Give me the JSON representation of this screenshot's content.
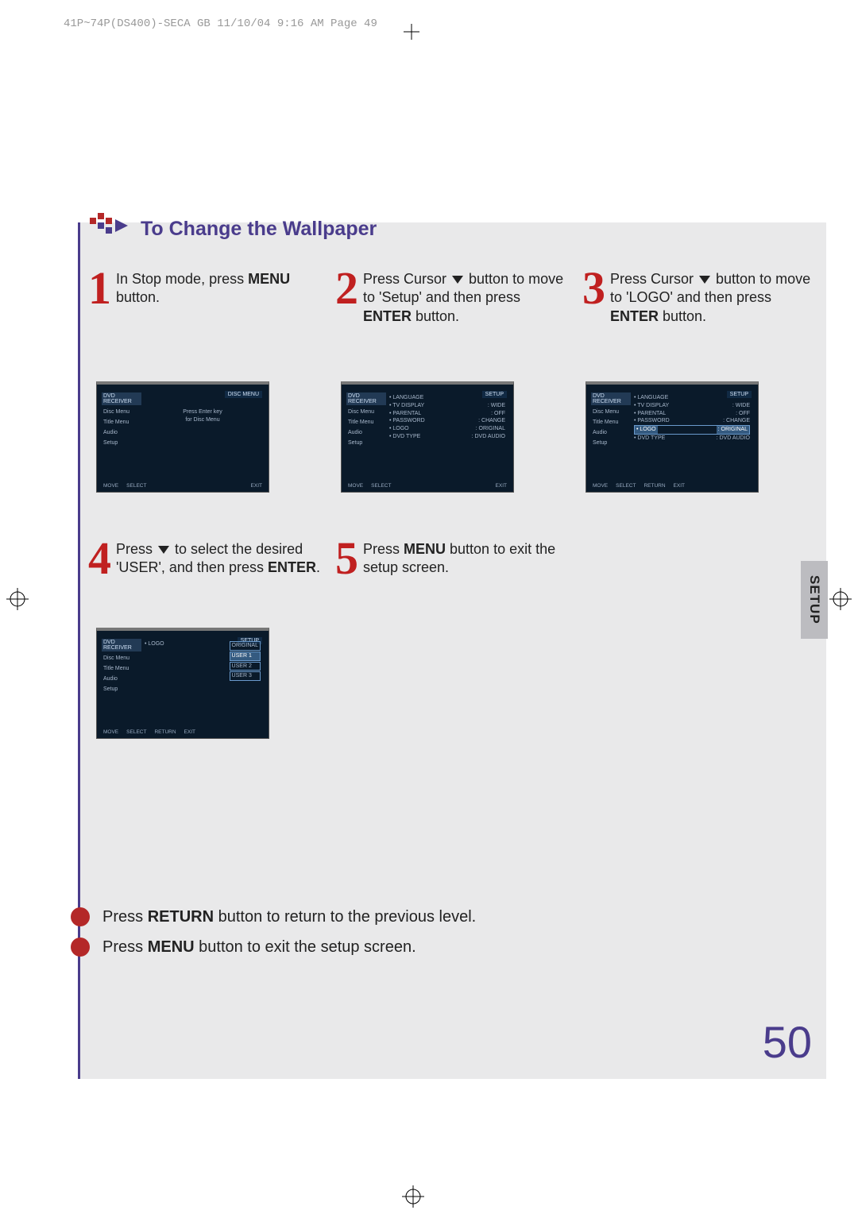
{
  "header": "41P~74P(DS400)-SECA GB  11/10/04 9:16 AM  Page 49",
  "section_title": "To Change the Wallpaper",
  "side_tab": "SETUP",
  "page_number": "50",
  "steps": [
    {
      "num": "1",
      "text_before": "In Stop mode, press ",
      "bold1": "MENU",
      "text_mid": " button.",
      "bold2": "",
      "text_after": ""
    },
    {
      "num": "2",
      "text_before": "Press Cursor ▼ button to move to 'Setup' and then press ",
      "bold1": "ENTER",
      "text_mid": " button.",
      "bold2": "",
      "text_after": ""
    },
    {
      "num": "3",
      "text_before": "Press Cursor ▼ button to move to 'LOGO' and then press ",
      "bold1": "ENTER",
      "text_mid": " button.",
      "bold2": "",
      "text_after": ""
    }
  ],
  "steps2": [
    {
      "num": "4",
      "text_before": "Press ▼ to select the desired 'USER', and then press ",
      "bold1": "ENTER",
      "text_mid": ".",
      "bold2": "",
      "text_after": ""
    },
    {
      "num": "5",
      "text_before": "Press ",
      "bold1": "MENU",
      "text_mid": " button to exit the setup screen.",
      "bold2": "",
      "text_after": ""
    }
  ],
  "notes": [
    {
      "before": "Press ",
      "bold": "RETURN",
      "after": " button to return to the previous level."
    },
    {
      "before": "Press ",
      "bold": "MENU",
      "after": " button to exit the setup screen."
    }
  ],
  "shot1": {
    "brand": "DVD RECEIVER",
    "corner": "DISC MENU",
    "sidebar": [
      "Disc Menu",
      "Title Menu",
      "Audio",
      "Setup"
    ],
    "center1": "Press Enter key",
    "center2": "for Disc Menu",
    "foot": [
      "MOVE",
      "SELECT",
      "EXIT"
    ]
  },
  "shot2": {
    "brand": "DVD RECEIVER",
    "corner": "SETUP",
    "sidebar": [
      "Disc Menu",
      "Title Menu",
      "Audio",
      "Setup"
    ],
    "rows": [
      [
        "LANGUAGE",
        ""
      ],
      [
        "TV DISPLAY",
        ": WIDE"
      ],
      [
        "PARENTAL",
        ": OFF"
      ],
      [
        "PASSWORD",
        ": CHANGE"
      ],
      [
        "LOGO",
        ": ORIGINAL"
      ],
      [
        "DVD TYPE",
        ": DVD AUDIO"
      ]
    ],
    "foot": [
      "MOVE",
      "SELECT",
      "EXIT"
    ]
  },
  "shot3": {
    "brand": "DVD RECEIVER",
    "corner": "SETUP",
    "sidebar": [
      "Disc Menu",
      "Title Menu",
      "Audio",
      "Setup"
    ],
    "rows": [
      [
        "LANGUAGE",
        ""
      ],
      [
        "TV DISPLAY",
        ": WIDE"
      ],
      [
        "PARENTAL",
        ": OFF"
      ],
      [
        "PASSWORD",
        ": CHANGE"
      ],
      [
        "LOGO",
        ": ORIGINAL"
      ],
      [
        "DVD TYPE",
        ": DVD AUDIO"
      ]
    ],
    "highlight_row": 4,
    "foot": [
      "MOVE",
      "SELECT",
      "RETURN",
      "EXIT"
    ]
  },
  "shot4": {
    "brand": "DVD RECEIVER",
    "corner": "SETUP",
    "sidebar": [
      "Disc Menu",
      "Title Menu",
      "Audio",
      "Setup"
    ],
    "col1": "LOGO",
    "options": [
      "ORIGINAL",
      "USER 1",
      "USER 2",
      "USER 3"
    ],
    "selected": 1,
    "foot": [
      "MOVE",
      "SELECT",
      "RETURN",
      "EXIT"
    ]
  }
}
